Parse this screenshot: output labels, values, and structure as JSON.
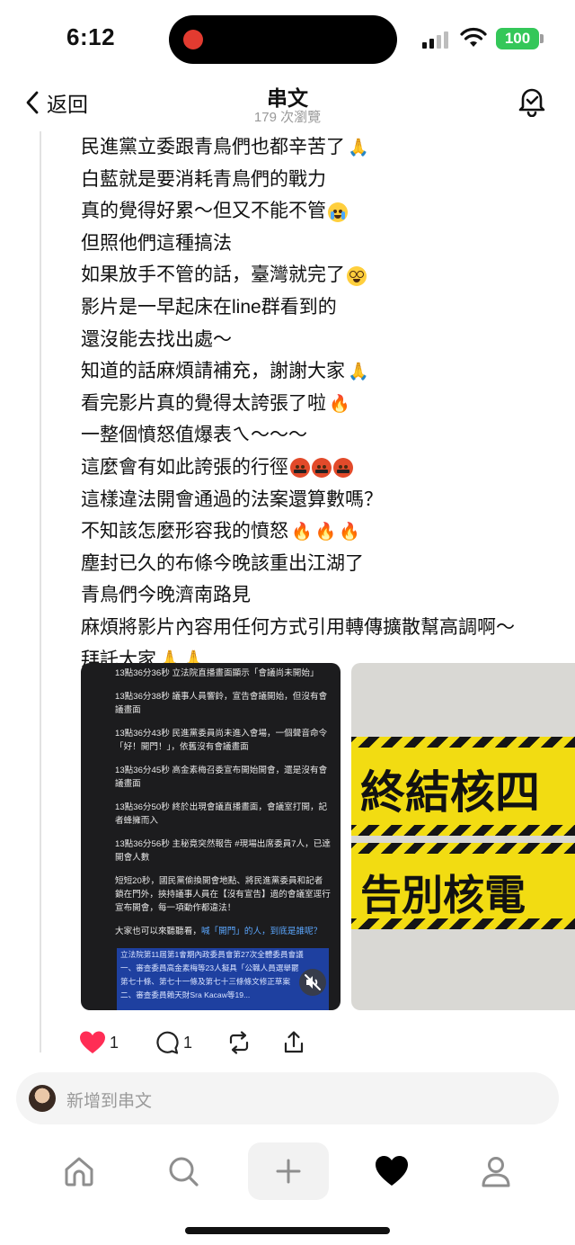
{
  "status": {
    "time": "6:12",
    "battery": "100"
  },
  "header": {
    "back_label": "返回",
    "title": "串文",
    "views": "179 次瀏覽"
  },
  "post": {
    "lines": [
      {
        "text": "民進黨立委跟青鳥們也都辛苦了",
        "emoji": [
          "pray"
        ]
      },
      {
        "text": "白藍就是要消耗青鳥們的戰力",
        "emoji": []
      },
      {
        "text": "真的覺得好累～但又不能不管",
        "emoji": [
          "cry"
        ]
      },
      {
        "text": "但照他們這種搞法",
        "emoji": []
      },
      {
        "text": "如果放手不管的話，臺灣就完了",
        "emoji": [
          "dizzy"
        ]
      },
      {
        "text": "影片是一早起床在line群看到的",
        "emoji": []
      },
      {
        "text": "還沒能去找出處～",
        "emoji": []
      },
      {
        "text": "知道的話麻煩請補充，謝謝大家",
        "emoji": [
          "pray"
        ]
      },
      {
        "text": "看完影片真的覺得太誇張了啦",
        "emoji": [
          "fire"
        ]
      },
      {
        "text": "一整個憤怒值爆表ㄟ～～～",
        "emoji": []
      },
      {
        "text": "這麼會有如此誇張的行徑",
        "emoji": [
          "angry",
          "angry",
          "angry"
        ]
      },
      {
        "text": "這樣違法開會通過的法案還算數嗎？",
        "emoji": []
      },
      {
        "text": "不知該怎麼形容我的憤怒",
        "emoji": [
          "fire",
          "fire",
          "fire"
        ]
      },
      {
        "text": "塵封已久的布條今晚該重出江湖了",
        "emoji": []
      },
      {
        "text": "青鳥們今晚濟南路見",
        "emoji": []
      },
      {
        "text": "麻煩將影片內容用任何方式引用轉傳擴散幫高調啊～",
        "emoji": []
      },
      {
        "text": "拜託大家",
        "emoji": [
          "pray",
          "pray"
        ]
      }
    ],
    "emoji_glyphs": {
      "pray": "🙏",
      "fire": "🔥"
    },
    "media_video": {
      "items": [
        "13點36分36秒 立法院直播畫面顯示「會議尚未開始」",
        "13點36分38秒 議事人員響鈴，宣告會議開始，但沒有會議畫面",
        "13點36分43秒 民進黨委員尚未進入會場，一個聲音命令「好！開門！」，依舊沒有會議畫面",
        "13點36分45秒 高金素梅召委宣布開始開會，還是沒有會議畫面",
        "13點36分50秒 終於出現會議直播畫面，會議室打開，記者蜂擁而入",
        "13點36分56秒 主秘竟突然報告 #現場出席委員7人，已達開會人數",
        "短短20秒，國民黨偷換開會地點、將民進黨委員和記者鎖在門外，挾持議事人員在【沒有宣告】過的會議室逕行宣布開會，每一項動作都違法！"
      ],
      "closing_text": "大家也可以來聽聽看，",
      "closing_link": "喊「開門」的人，到底是誰呢？",
      "doc_lines": [
        "立法院第11屆第1會期內政委員會第27次全體委員會議",
        "一、審查委員高金素梅等23人擬具「公職人員選舉罷",
        "第七十條、第七十一條及第七十三條條文修正草案",
        "二、審查委員賴天財Sra Kacaw等19..."
      ]
    },
    "media_photo": {
      "sign_top": "終結核四",
      "sign_bottom": "告別核電"
    },
    "actions": {
      "likes": "1",
      "comments": "1"
    }
  },
  "reply": {
    "placeholder": "新增到串文"
  },
  "colors": {
    "like": "#ff2d55",
    "battery": "#34c759",
    "sign_yellow": "#f2dc12",
    "record_dot": "#e23b30"
  }
}
